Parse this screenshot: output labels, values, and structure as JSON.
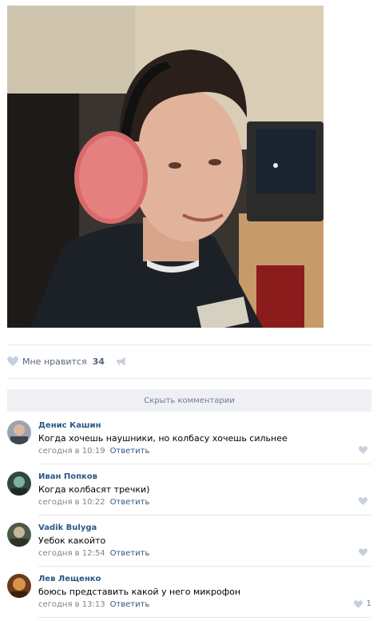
{
  "post": {
    "photo_alt": "photo",
    "likes": {
      "label": "Мне нравится",
      "count": "34"
    }
  },
  "comments_section": {
    "hide_label": "Скрыть комментарии",
    "reply_label": "Ответить",
    "items": [
      {
        "author": "Денис Кашин",
        "text": "Когда хочешь наушники, но колбасу хочешь сильнее",
        "time": "сегодня в 10:19",
        "likes": ""
      },
      {
        "author": "Иван Попков",
        "text": "Когда колбасят тречки)",
        "time": "сегодня в 10:22",
        "likes": ""
      },
      {
        "author": "Vadik Bulyga",
        "text": "Уебок какойто",
        "time": "сегодня в 12:54",
        "likes": ""
      },
      {
        "author": "Лев Лещенко",
        "text": "боюсь представить какой у него микрофон",
        "time": "сегодня в 13:13",
        "likes": "1"
      }
    ]
  },
  "colors": {
    "link": "#2a5885",
    "muted": "#828282",
    "icon": "#c5d0db",
    "divider": "#e7e8ec"
  }
}
